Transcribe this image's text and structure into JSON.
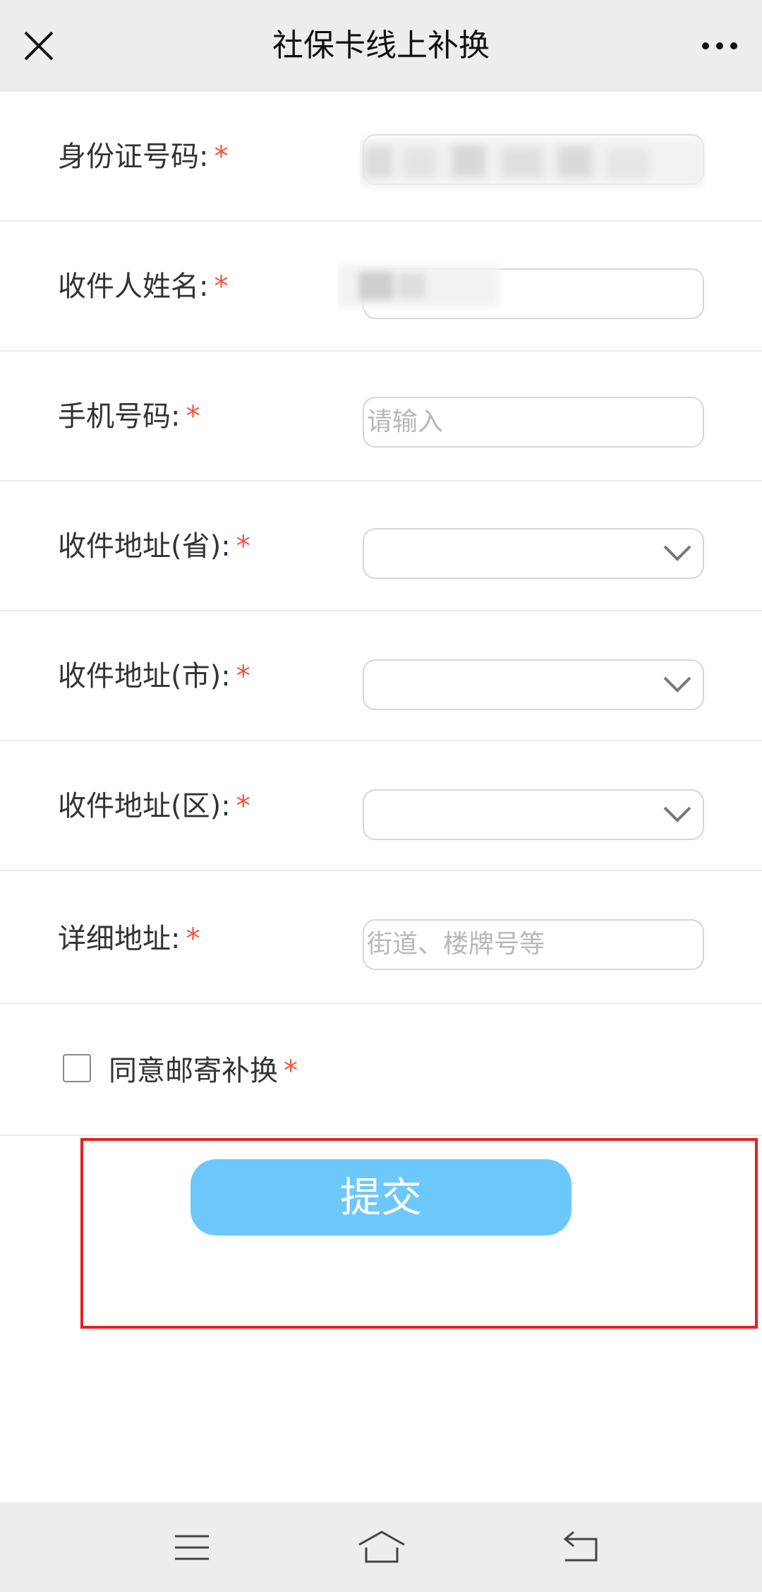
{
  "header": {
    "title": "社保卡线上补换",
    "close_icon": "close-icon",
    "more_icon": "more-dots-icon"
  },
  "form": {
    "required_mark": "*",
    "fields": [
      {
        "label": "身份证号码:",
        "type": "text",
        "value": "",
        "placeholder": ""
      },
      {
        "label": "收件人姓名:",
        "type": "text",
        "value": "",
        "placeholder": ""
      },
      {
        "label": "手机号码:",
        "type": "text",
        "value": "",
        "placeholder": "请输入"
      },
      {
        "label": "收件地址(省):",
        "type": "select",
        "value": "",
        "icon": "chevron-down-icon"
      },
      {
        "label": "收件地址(市):",
        "type": "select",
        "value": "",
        "icon": "chevron-down-icon"
      },
      {
        "label": "收件地址(区):",
        "type": "select",
        "value": "",
        "icon": "chevron-down-icon"
      },
      {
        "label": "详细地址:",
        "type": "text",
        "value": "",
        "placeholder": "街道、楼牌号等"
      }
    ],
    "agree_label": "同意邮寄补换",
    "agree_checked": false,
    "submit_label": "提交"
  },
  "colors": {
    "accent_button": "#6cc8fa",
    "required_star": "#f4533f",
    "highlight_border": "#e52020"
  },
  "bottom_nav": {
    "icons": [
      "menu-icon",
      "home-icon",
      "back-icon"
    ]
  }
}
